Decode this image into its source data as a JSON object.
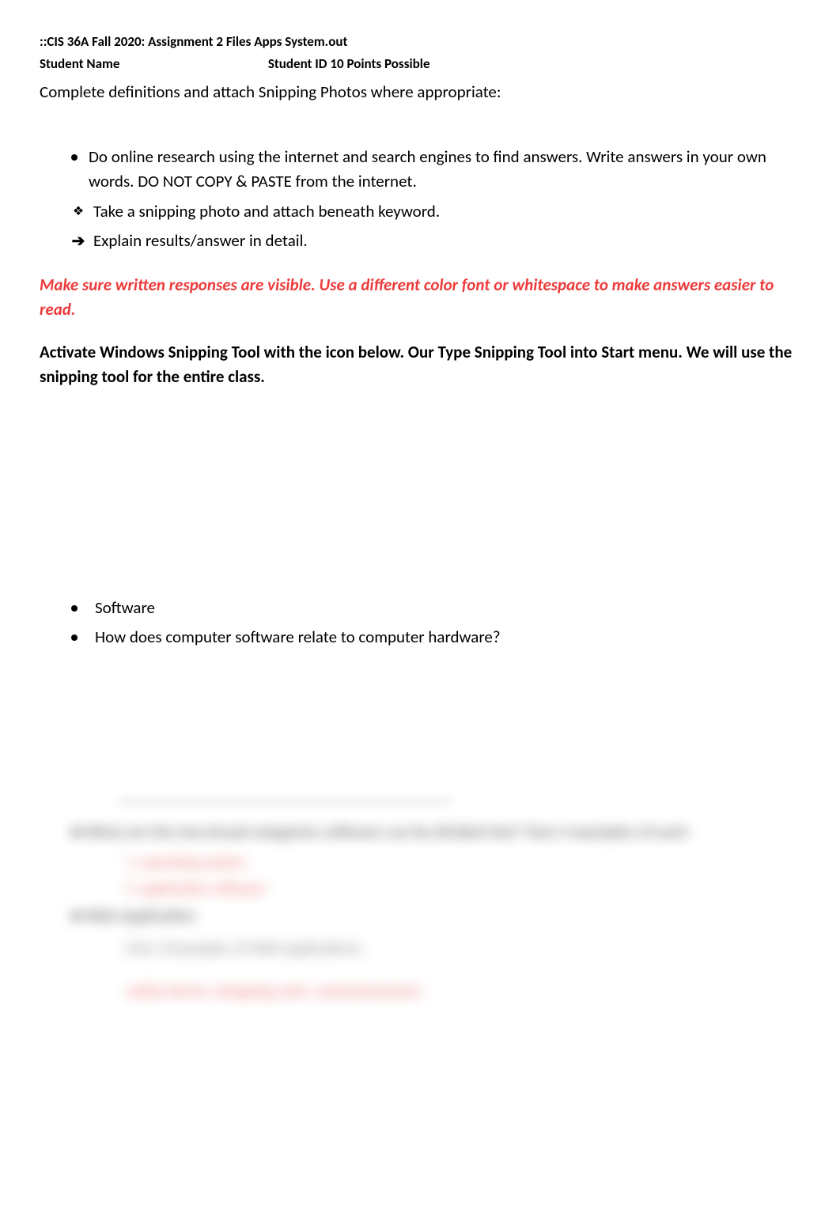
{
  "header": {
    "course": "::CIS 36A Fall 2020: Assignment 2 Files Apps System.out",
    "student_name_label": "Student Name",
    "student_id_label": "Student ID 10 Points Possible"
  },
  "intro": "Complete definitions and attach Snipping Photos where appropriate:",
  "instructions": [
    "Do online research using the internet and search engines to find answers. Write answers in your own words. DO NOT COPY & PASTE from the internet.",
    "Take a snipping photo and attach beneath keyword.",
    "Explain results/answer in detail."
  ],
  "note": "Make sure written responses are visible. Use a different color font or whitespace to make answers easier to read.",
  "activate": "Activate Windows Snipping Tool with the icon below. Our Type Snipping Tool into Start menu. We will use the snipping tool for the entire class.",
  "questions": [
    "Software",
    "How does computer software relate to computer hardware?"
  ],
  "blurred": {
    "q1": "What are the two broad categories software can be divided into? Give 4 examples of each",
    "q1a": "1. operating system",
    "q1b": "2. application software",
    "q2": "Web Application",
    "q2sub": "Give 3 Examples of Web applications",
    "q2ans": "online forms, shopping carts, word processors"
  }
}
